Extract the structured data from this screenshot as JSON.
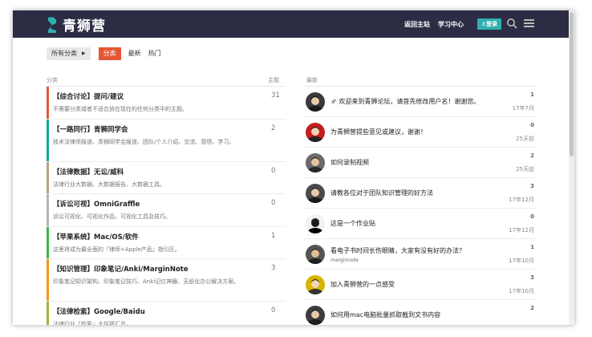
{
  "header": {
    "site_name": "青狮营",
    "nav_home": "返回主站",
    "nav_learn": "学习中心",
    "login_label": "登录",
    "brand_color": "#2c2c44",
    "accent": "#2eb0b0"
  },
  "filters": {
    "category_dropdown": "所有分类",
    "tab_categories": "分类",
    "tab_latest": "最新",
    "tab_hot": "热门"
  },
  "categories_table": {
    "header_category": "分类",
    "header_topics": "主题",
    "rows": [
      {
        "title": "【综合讨论】提问/建议",
        "desc": "不需要分类或者不适合放在现在的任何分类中的主题。",
        "count": "31",
        "color": "#e45735"
      },
      {
        "title": "【一路同行】青狮同学会",
        "desc": "技术法律师报道、青狮同学会报道、团队/个人介绍、交流、感悟、学习。",
        "count": "2",
        "color": "#12a89d"
      },
      {
        "title": "【法律数据】无讼/威科",
        "desc": "法律行业大数据、大数据报告、大数据工具。",
        "count": "0",
        "color": "#b3a480"
      },
      {
        "title": "【诉讼可视】OmniGraffle",
        "desc": "诉讼可视化、可视化作品、可视化工具及技巧。",
        "count": "0",
        "color": "#b3b5b4"
      },
      {
        "title": "【苹果系统】Mac/OS/软件",
        "desc": "这里将成为最全面的「律师+Apple产品」指引区。",
        "count": "1",
        "color": "#3ab54a"
      },
      {
        "title": "【知识管理】印象笔记/Anki/MarginNote",
        "desc": "印象笔记知识架构、印象笔记技巧、Anki记忆神器、无纸化办公解决方案。",
        "count": "3",
        "color": "#f7941d"
      },
      {
        "title": "【法律检索】Google/Baidu",
        "desc": "法律行业「检索」大括那汇总。",
        "count": "0",
        "color": "#9eb83b"
      }
    ]
  },
  "latest": {
    "header": "最新",
    "topics": [
      {
        "title": "欢迎来到青狮论坛，请首先修改用户名！谢谢您。",
        "sub": "",
        "count": "1",
        "time": "17年7月",
        "pinned": true
      },
      {
        "title": "为青狮营提些意见或建议，谢谢！",
        "sub": "",
        "count": "0",
        "time": "25天前",
        "pinned": false
      },
      {
        "title": "如何录制视频",
        "sub": "",
        "count": "2",
        "time": "25天前",
        "pinned": false
      },
      {
        "title": "请教各位对于团队知识管理的好方法",
        "sub": "",
        "count": "3",
        "time": "17年12月",
        "pinned": false
      },
      {
        "title": "这是一个作业贴",
        "sub": "",
        "count": "0",
        "time": "17年12月",
        "pinned": false
      },
      {
        "title": "看电子书时间长伤眼睛，大家有没有好的办法？",
        "sub": "marginnote",
        "count": "1",
        "time": "17年10月",
        "pinned": false
      },
      {
        "title": "加入青狮营的一点感受",
        "sub": "",
        "count": "3",
        "time": "17年10月",
        "pinned": false
      },
      {
        "title": "如何用mac电脑批量抓取截到文书内容",
        "sub": "",
        "count": "2",
        "time": "",
        "pinned": false
      }
    ]
  }
}
